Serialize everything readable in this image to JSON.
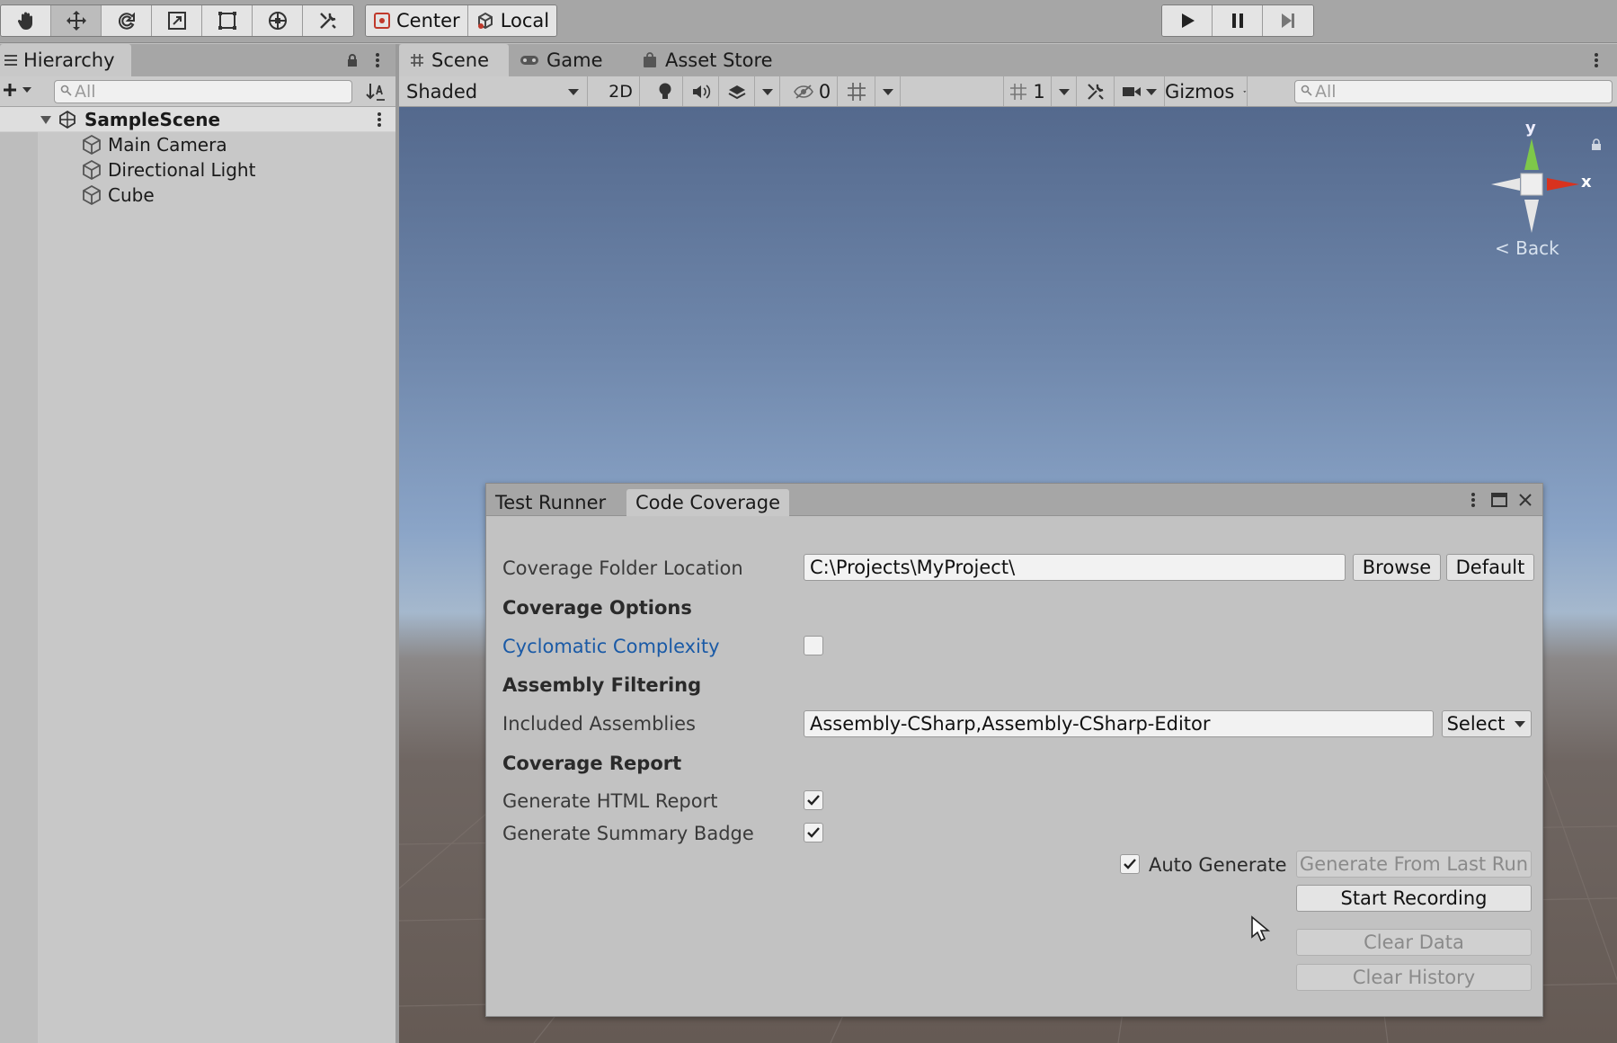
{
  "toolbar": {
    "pivot_label": "Center",
    "space_label": "Local"
  },
  "hierarchy": {
    "title": "Hierarchy",
    "search_placeholder": "All",
    "scene_name": "SampleScene",
    "items": [
      {
        "label": "Main Camera"
      },
      {
        "label": "Directional Light"
      },
      {
        "label": "Cube"
      }
    ]
  },
  "scene": {
    "tabs": [
      {
        "label": "Scene"
      },
      {
        "label": "Game"
      },
      {
        "label": "Asset Store"
      }
    ],
    "draw_mode": "Shaded",
    "mode_2d": "2D",
    "hidden_count": "0",
    "grid_count": "1",
    "gizmos_label": "Gizmos",
    "search_placeholder": "All",
    "gizmo": {
      "y_label": "y",
      "x_label": "x",
      "back_label": "< Back"
    }
  },
  "coverage_window": {
    "tabs": [
      {
        "label": "Test Runner"
      },
      {
        "label": "Code Coverage"
      }
    ],
    "folder_label": "Coverage Folder Location",
    "folder_value": "C:\\Projects\\MyProject\\",
    "browse_label": "Browse",
    "default_label": "Default",
    "coverage_options_label": "Coverage Options",
    "cyclomatic_label": "Cyclomatic Complexity",
    "cyclomatic_checked": false,
    "assembly_filtering_label": "Assembly Filtering",
    "included_label": "Included Assemblies",
    "included_value": "Assembly-CSharp,Assembly-CSharp-Editor",
    "select_label": "Select",
    "coverage_report_label": "Coverage Report",
    "html_report_label": "Generate HTML Report",
    "html_report_checked": true,
    "summary_badge_label": "Generate Summary Badge",
    "summary_badge_checked": true,
    "auto_generate_label": "Auto Generate",
    "auto_generate_checked": true,
    "generate_last_run_label": "Generate From Last Run",
    "start_recording_label": "Start Recording",
    "clear_data_label": "Clear Data",
    "clear_history_label": "Clear History"
  },
  "colors": {
    "link_blue": "#1a5aa6",
    "gizmo_y": "#7ec84a",
    "gizmo_x": "#d8321e"
  }
}
